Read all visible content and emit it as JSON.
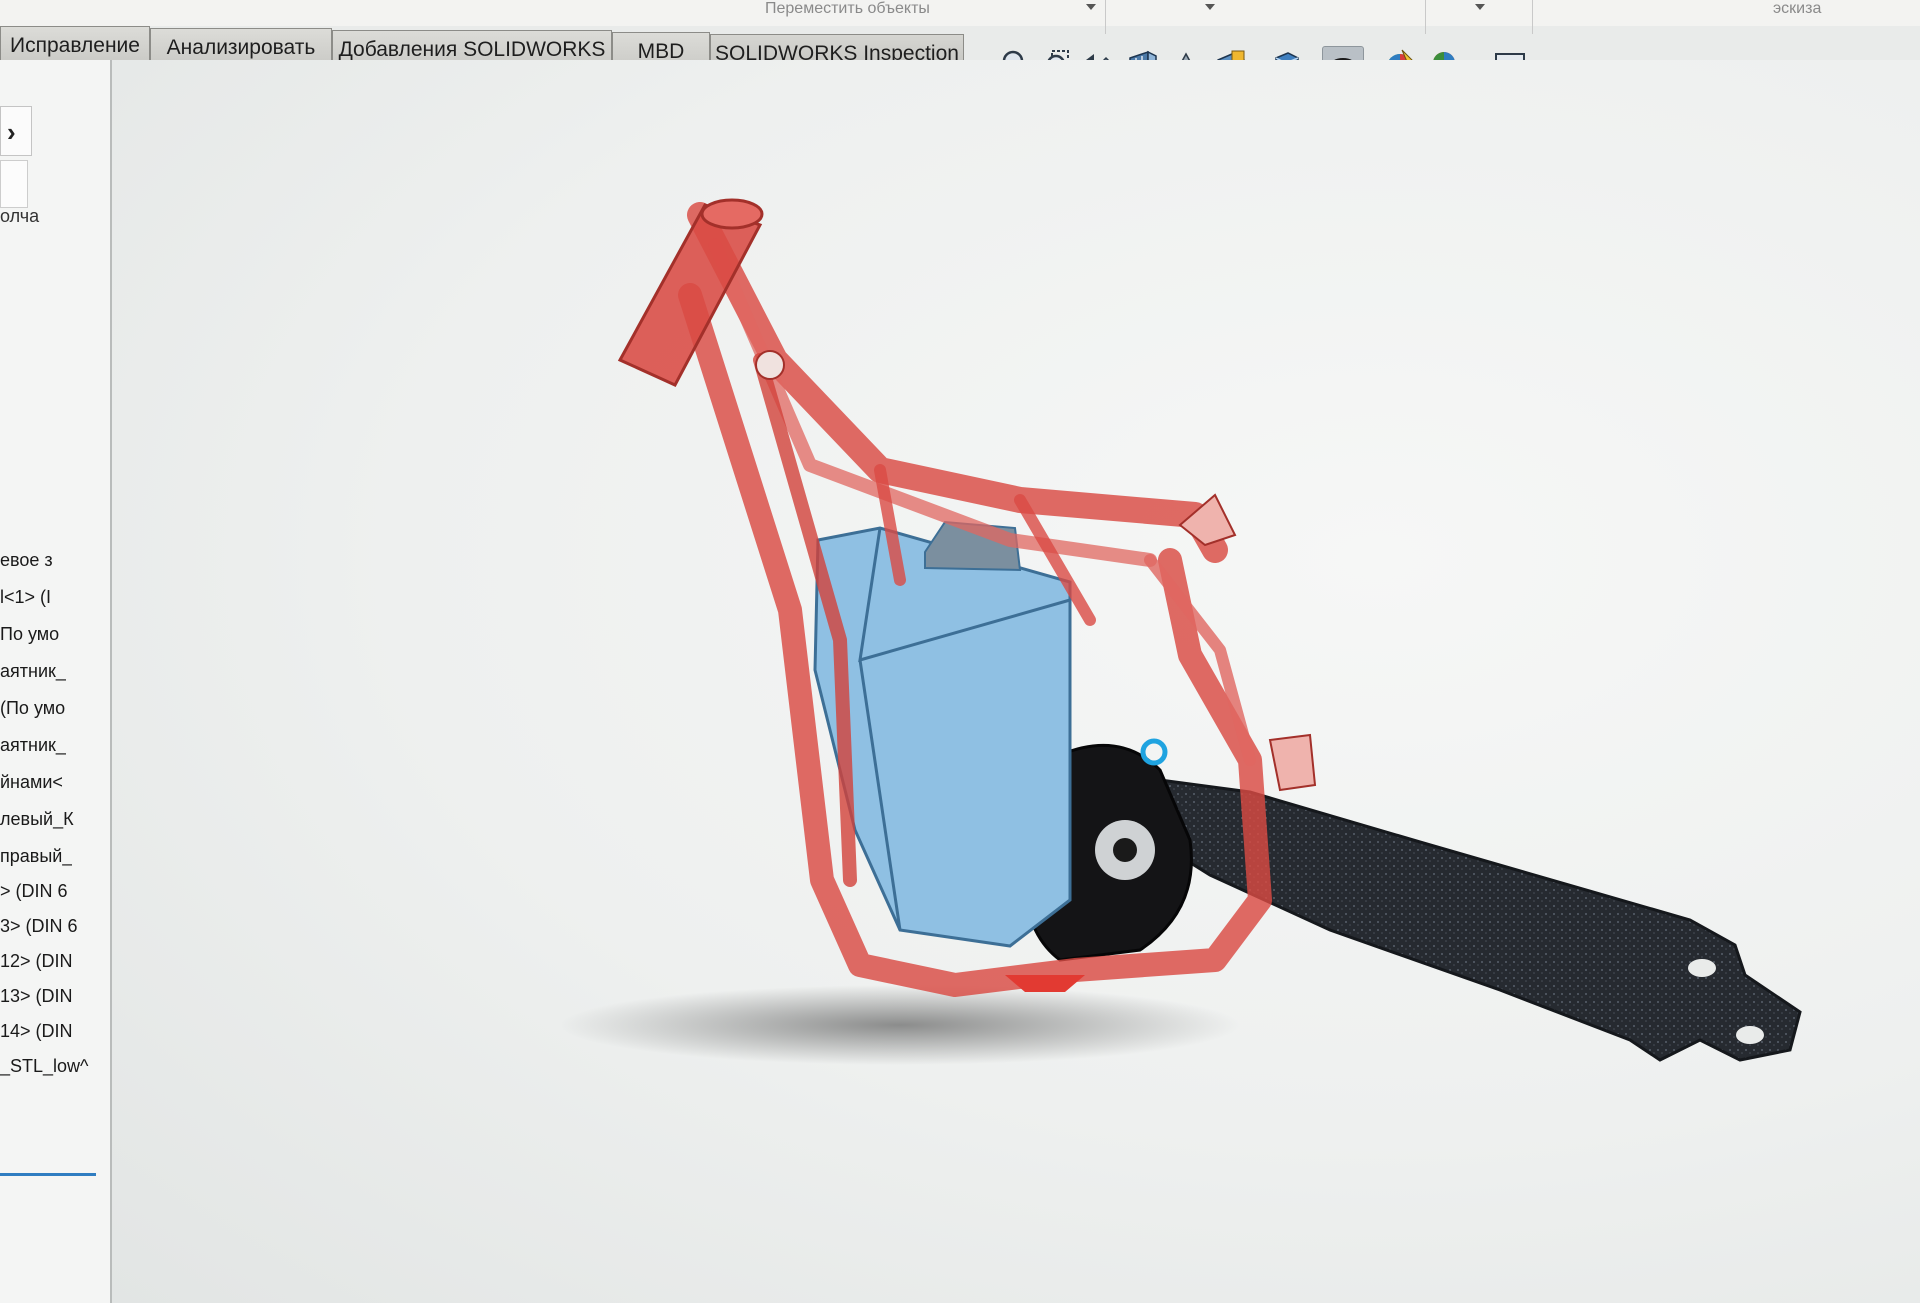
{
  "top_strip": {
    "move_objects_label": "Переместить объекты",
    "sketch_label": "эскиза"
  },
  "tabs": [
    {
      "label": "Исправление"
    },
    {
      "label": "Анализировать"
    },
    {
      "label": "Добавления SOLIDWORKS"
    },
    {
      "label": "MBD"
    },
    {
      "label": "SOLIDWORKS Inspection"
    }
  ],
  "view_toolbar": [
    {
      "icon": "zoom-to-fit-icon"
    },
    {
      "icon": "zoom-to-area-icon"
    },
    {
      "icon": "previous-view-icon"
    },
    {
      "icon": "section-view-icon"
    },
    {
      "icon": "dynamic-annotation-views-icon"
    },
    {
      "icon": "view-orientation-icon"
    },
    {
      "icon": "display-style-icon"
    },
    {
      "icon": "hide-show-items-icon"
    },
    {
      "icon": "edit-appearance-icon"
    },
    {
      "icon": "apply-scene-icon"
    },
    {
      "icon": "view-settings-icon"
    }
  ],
  "feature_tree": {
    "truncated_top": "олча",
    "items": [
      "евое з",
      "l<1> (I",
      "По умо",
      "аятник_",
      "(По умо",
      "аятник_",
      "йнами<",
      "левый_К",
      "правый_",
      "> (DIN 6",
      "3> (DIN 6",
      "12> (DIN",
      "13> (DIN",
      "14> (DIN",
      "_STL_low^"
    ]
  },
  "model_colors": {
    "frame": "#d94a43",
    "battery": "#8fc0e3",
    "swingarm": "#2b2f36",
    "background": "#eef0ef"
  }
}
